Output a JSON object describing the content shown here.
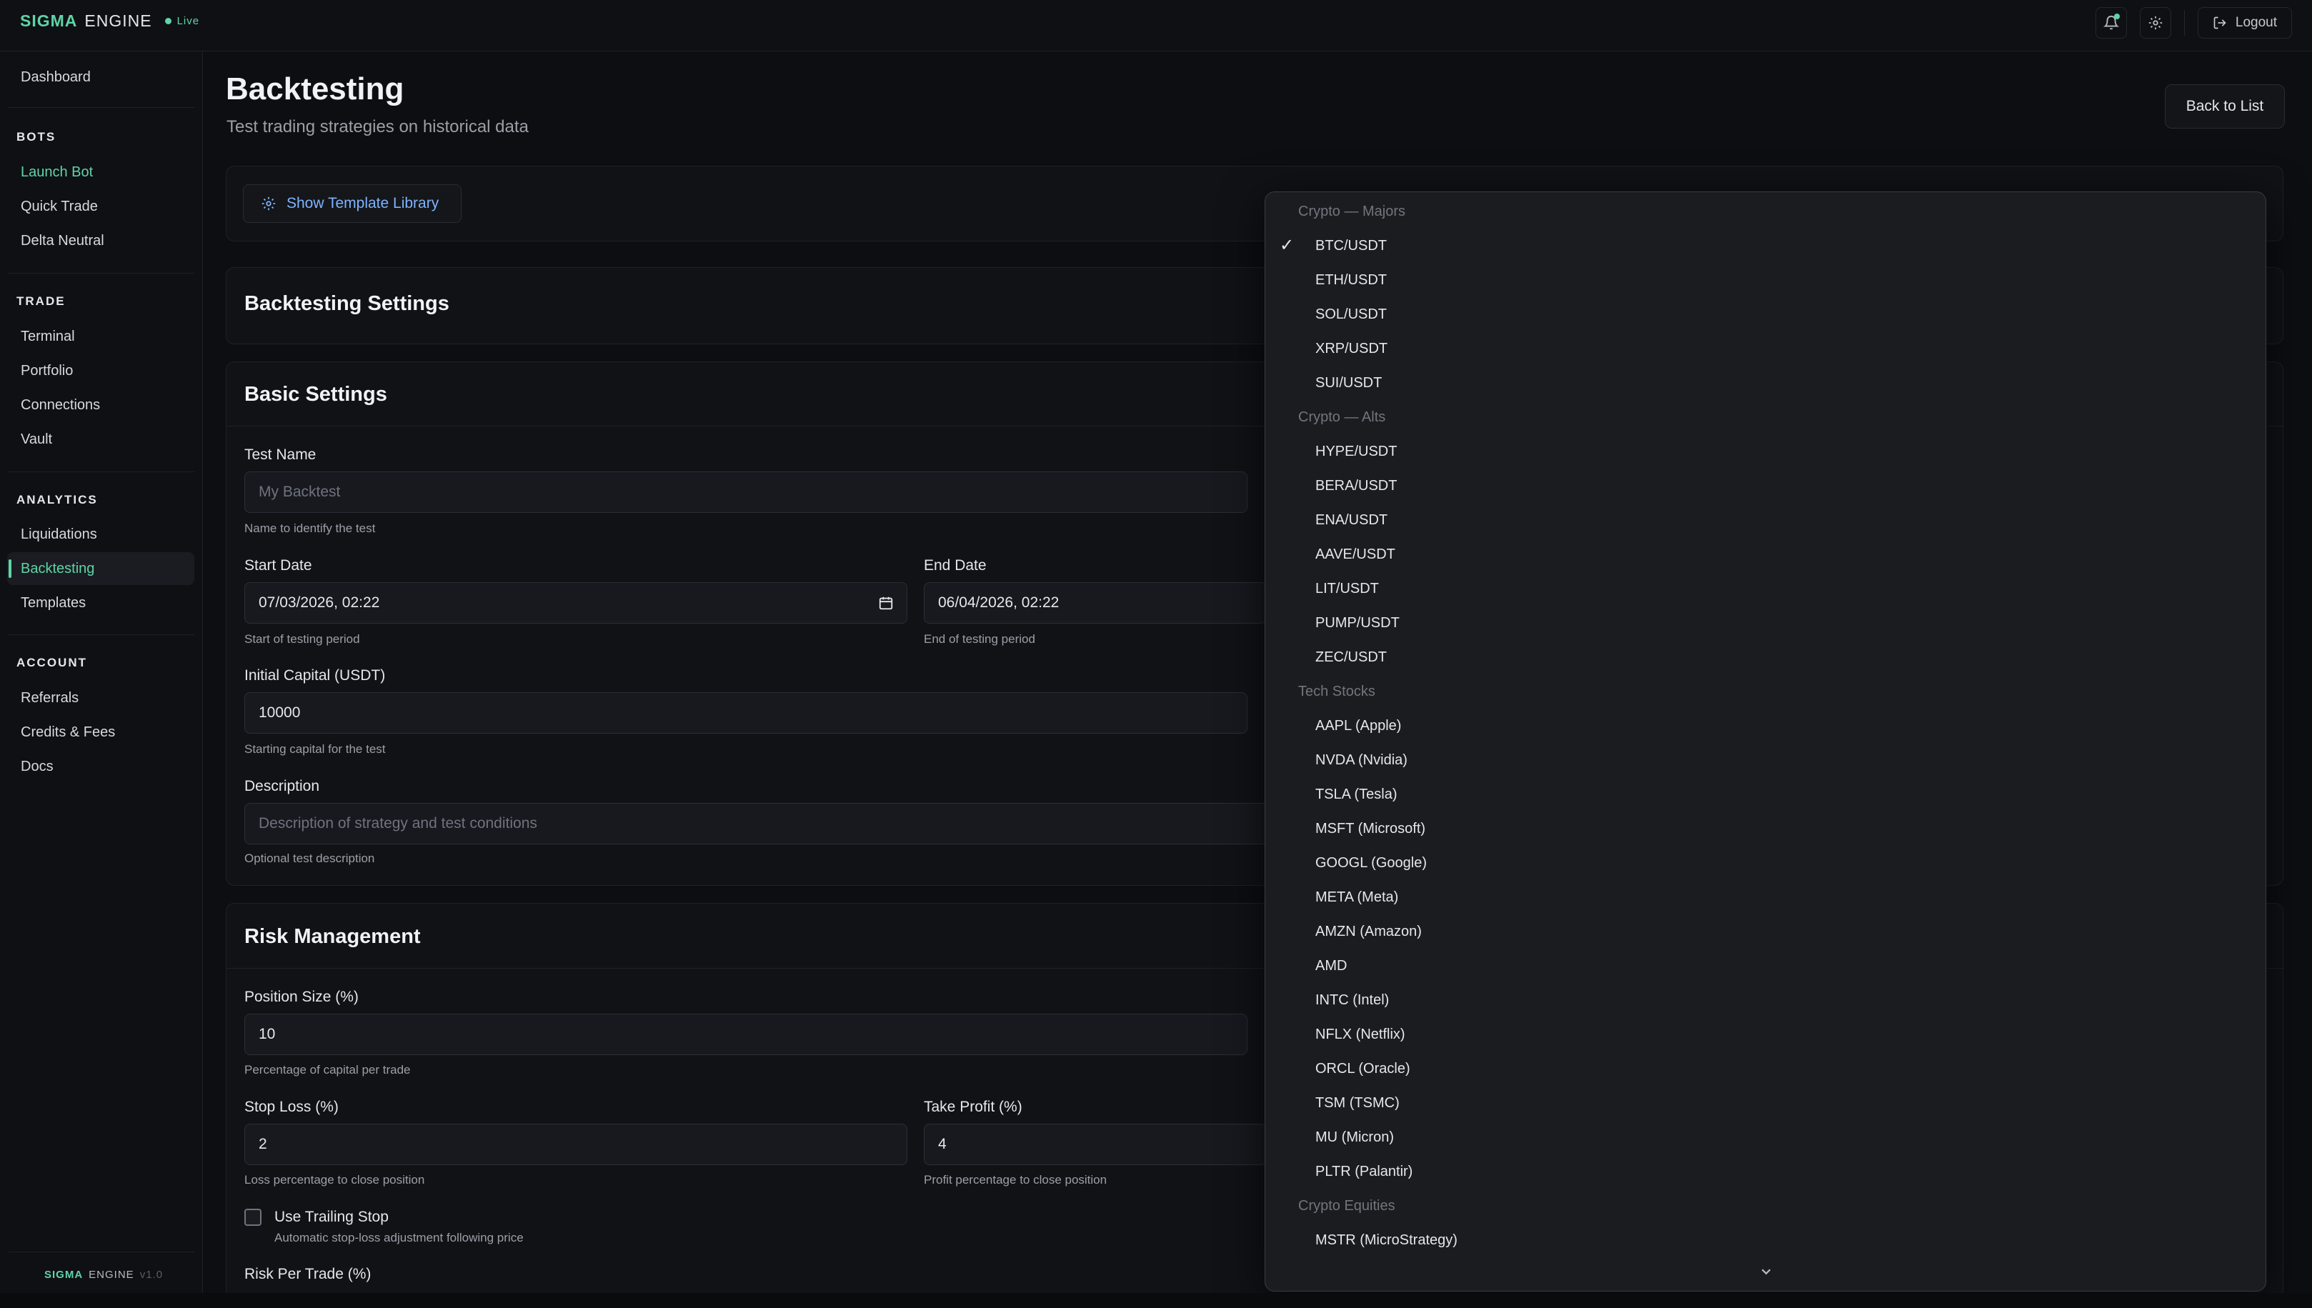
{
  "topbar": {
    "brand_primary": "SIGMA",
    "brand_secondary": "ENGINE",
    "status": "Live",
    "logout_label": "Logout",
    "icons": [
      "bell-icon",
      "gear-icon",
      "logout-icon"
    ]
  },
  "sidebar": {
    "dashboard": "Dashboard",
    "groups": [
      {
        "title": "BOTS",
        "items": [
          "Launch Bot",
          "Quick Trade",
          "Delta Neutral"
        ]
      },
      {
        "title": "TRADE",
        "items": [
          "Terminal",
          "Portfolio",
          "Connections",
          "Vault"
        ]
      },
      {
        "title": "ANALYTICS",
        "items": [
          "Liquidations",
          "Backtesting",
          "Templates"
        ]
      },
      {
        "title": "ACCOUNT",
        "items": [
          "Referrals",
          "Credits & Fees",
          "Docs"
        ]
      }
    ],
    "active_item": "Backtesting",
    "footer_primary": "SIGMA",
    "footer_secondary": "ENGINE",
    "footer_version": "v1.0"
  },
  "header": {
    "title": "Backtesting",
    "subtitle": "Test trading strategies on historical data",
    "back_label": "Back to List"
  },
  "template_library": {
    "label": "Show Template Library"
  },
  "settings_panel": {
    "title": "Backtesting Settings"
  },
  "basic": {
    "title": "Basic Settings",
    "test_name": {
      "label": "Test Name",
      "placeholder": "My Backtest",
      "hint": "Name to identify the test"
    },
    "start_date": {
      "label": "Start Date",
      "value": "07/03/2026, 02:22",
      "hint": "Start of testing period"
    },
    "end_date": {
      "label": "End Date",
      "value": "06/04/2026, 02:22",
      "hint": "End of testing period"
    },
    "capital": {
      "label": "Initial Capital (USDT)",
      "value": "10000",
      "hint": "Starting capital for the test"
    },
    "description": {
      "label": "Description",
      "placeholder": "Description of strategy and test conditions",
      "hint": "Optional test description"
    }
  },
  "risk": {
    "title": "Risk Management",
    "position_size": {
      "label": "Position Size (%)",
      "value": "10",
      "hint": "Percentage of capital per trade"
    },
    "stop_loss": {
      "label": "Stop Loss (%)",
      "value": "2",
      "hint": "Loss percentage to close position"
    },
    "take_profit": {
      "label": "Take Profit (%)",
      "value": "4",
      "hint": "Profit percentage to close position"
    },
    "trailing": {
      "label": "Use Trailing Stop",
      "hint": "Automatic stop-loss adjustment following price"
    },
    "risk_per_trade": {
      "label": "Risk Per Trade (%)"
    }
  },
  "dropdown": {
    "selected": "BTC/USDT",
    "groups": [
      {
        "title": "Crypto — Majors",
        "options": [
          "BTC/USDT",
          "ETH/USDT",
          "SOL/USDT",
          "XRP/USDT",
          "SUI/USDT"
        ]
      },
      {
        "title": "Crypto — Alts",
        "options": [
          "HYPE/USDT",
          "BERA/USDT",
          "ENA/USDT",
          "AAVE/USDT",
          "LIT/USDT",
          "PUMP/USDT",
          "ZEC/USDT"
        ]
      },
      {
        "title": "Tech Stocks",
        "options": [
          "AAPL (Apple)",
          "NVDA (Nvidia)",
          "TSLA (Tesla)",
          "MSFT (Microsoft)",
          "GOOGL (Google)",
          "META (Meta)",
          "AMZN (Amazon)",
          "AMD",
          "INTC (Intel)",
          "NFLX (Netflix)",
          "ORCL (Oracle)",
          "TSM (TSMC)",
          "MU (Micron)",
          "PLTR (Palantir)"
        ]
      },
      {
        "title": "Crypto Equities",
        "options": [
          "MSTR (MicroStrategy)"
        ]
      }
    ]
  }
}
